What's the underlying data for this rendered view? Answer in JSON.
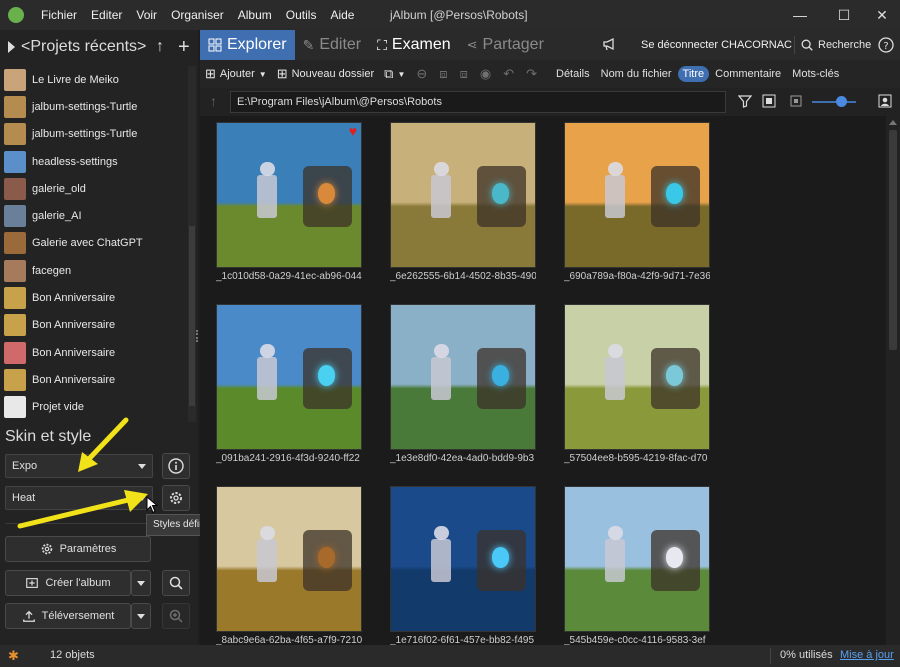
{
  "app": {
    "window_title": "jAlbum [@Persos\\Robots]",
    "menu": [
      "Fichier",
      "Editer",
      "Voir",
      "Organiser",
      "Album",
      "Outils",
      "Aide"
    ]
  },
  "projects": {
    "title": "<Projets récents>",
    "items": [
      {
        "label": "Le Livre de Meiko",
        "color": "#c9a37a"
      },
      {
        "label": "jalbum-settings-Turtle",
        "color": "#b58c4f"
      },
      {
        "label": "jalbum-settings-Turtle",
        "color": "#b58c4f"
      },
      {
        "label": "headless-settings",
        "color": "#5a8fc9"
      },
      {
        "label": "galerie_old",
        "color": "#8a5a4a"
      },
      {
        "label": "galerie_AI",
        "color": "#6a7f9a"
      },
      {
        "label": "Galerie avec ChatGPT",
        "color": "#9a6a3a"
      },
      {
        "label": "facegen",
        "color": "#a67b5b"
      },
      {
        "label": "Bon Anniversaire",
        "color": "#c8a24a"
      },
      {
        "label": "Bon Anniversaire",
        "color": "#c8a24a"
      },
      {
        "label": "Bon Anniversaire",
        "color": "#d06a6a"
      },
      {
        "label": "Bon Anniversaire",
        "color": "#c8a24a"
      },
      {
        "label": "Projet vide",
        "color": "#e8e8e8"
      }
    ]
  },
  "skin": {
    "title": "Skin et style",
    "skin_value": "Expo",
    "style_value": "Heat",
    "tooltip": "Styles définis pour le skin actuel",
    "settings_label": "Paramètres",
    "create_label": "Créer l'album",
    "upload_label": "Téléversement"
  },
  "tabs": {
    "explorer": "Explorer",
    "edit": "Editer",
    "review": "Examen",
    "share": "Partager",
    "logout": "Se déconnecter CHACORNAC",
    "search": "Recherche"
  },
  "toolbar": {
    "add": "Ajouter",
    "new_folder": "Nouveau dossier",
    "sort": [
      "Détails",
      "Nom du fichier",
      "Titre",
      "Commentaire",
      "Mots-clés"
    ],
    "active_sort": "Titre"
  },
  "path": "E:\\Program Files\\jAlbum\\@Persos\\Robots",
  "images": [
    {
      "name": "_1c010d58-0a29-41ec-ab96-044",
      "sky": "#3a7fb8",
      "ground": "#6b8a2e",
      "accent": "#d88a3a",
      "favorite": true
    },
    {
      "name": "_6e262555-6b14-4502-8b35-490",
      "sky": "#c8b07a",
      "ground": "#8a7a3a",
      "accent": "#4ab8c8",
      "favorite": false
    },
    {
      "name": "_690a789a-f80a-42f9-9d71-7e36",
      "sky": "#e8a24a",
      "ground": "#7a6a2a",
      "accent": "#3ac8e8",
      "favorite": false
    },
    {
      "name": "_091ba241-2916-4f3d-9240-ff22",
      "sky": "#4a8ac8",
      "ground": "#5a8a2a",
      "accent": "#4ad0f0",
      "favorite": false
    },
    {
      "name": "_1e3e8df0-42ea-4ad0-bdd9-9b3",
      "sky": "#8ab0c8",
      "ground": "#4a7a3a",
      "accent": "#3ab0e0",
      "favorite": false
    },
    {
      "name": "_57504ee8-b595-4219-8fac-d70",
      "sky": "#c8d0a8",
      "ground": "#8a9a3a",
      "accent": "#7ac8d8",
      "favorite": false
    },
    {
      "name": "_8abc9e6a-62ba-4f65-a7f9-7210",
      "sky": "#d8c8a0",
      "ground": "#9a7a2a",
      "accent": "#a86a2a",
      "favorite": false
    },
    {
      "name": "_1e716f02-6f61-457e-bb82-f495",
      "sky": "#1a4a8a",
      "ground": "#123a6a",
      "accent": "#4ac8f8",
      "favorite": false
    },
    {
      "name": "_545b459e-c0cc-4116-9583-3ef",
      "sky": "#9ac0e0",
      "ground": "#5a8a3a",
      "accent": "#e8e8f0",
      "favorite": false
    }
  ],
  "status": {
    "count": "12 objets",
    "usage": "0% utilisés",
    "update": "Mise à jour"
  },
  "colors": {
    "accent": "#3f6fb0",
    "favorite": "#e02020",
    "arrow": "#f2e21a"
  }
}
